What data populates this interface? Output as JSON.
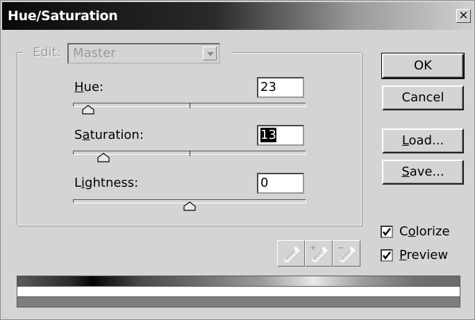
{
  "window": {
    "title": "Hue/Saturation",
    "close_glyph": "×"
  },
  "edit": {
    "label": "Edit:",
    "value": "Master"
  },
  "hue": {
    "label_pre": "",
    "label_ul": "H",
    "label_post": "ue:",
    "value": "23",
    "slider_fraction": 0.064
  },
  "saturation": {
    "label_pre": "S",
    "label_ul": "a",
    "label_post": "turation:",
    "value": "13",
    "slider_fraction": 0.13
  },
  "lightness": {
    "label_pre": "L",
    "label_ul": "i",
    "label_post": "ghtness:",
    "value": "0",
    "slider_fraction": 0.5
  },
  "buttons": {
    "ok": "OK",
    "cancel": "Cancel",
    "load_ul": "L",
    "load_post": "oad...",
    "save_ul": "S",
    "save_post": "ave..."
  },
  "colorize": {
    "label_pre": "C",
    "label_ul": "o",
    "label_post": "lorize",
    "checked": true
  },
  "preview": {
    "label_pre": "",
    "label_ul": "P",
    "label_post": "review",
    "checked": true
  },
  "eyedroppers": [
    "eyedropper-icon",
    "eyedropper-plus-icon",
    "eyedropper-minus-icon"
  ]
}
